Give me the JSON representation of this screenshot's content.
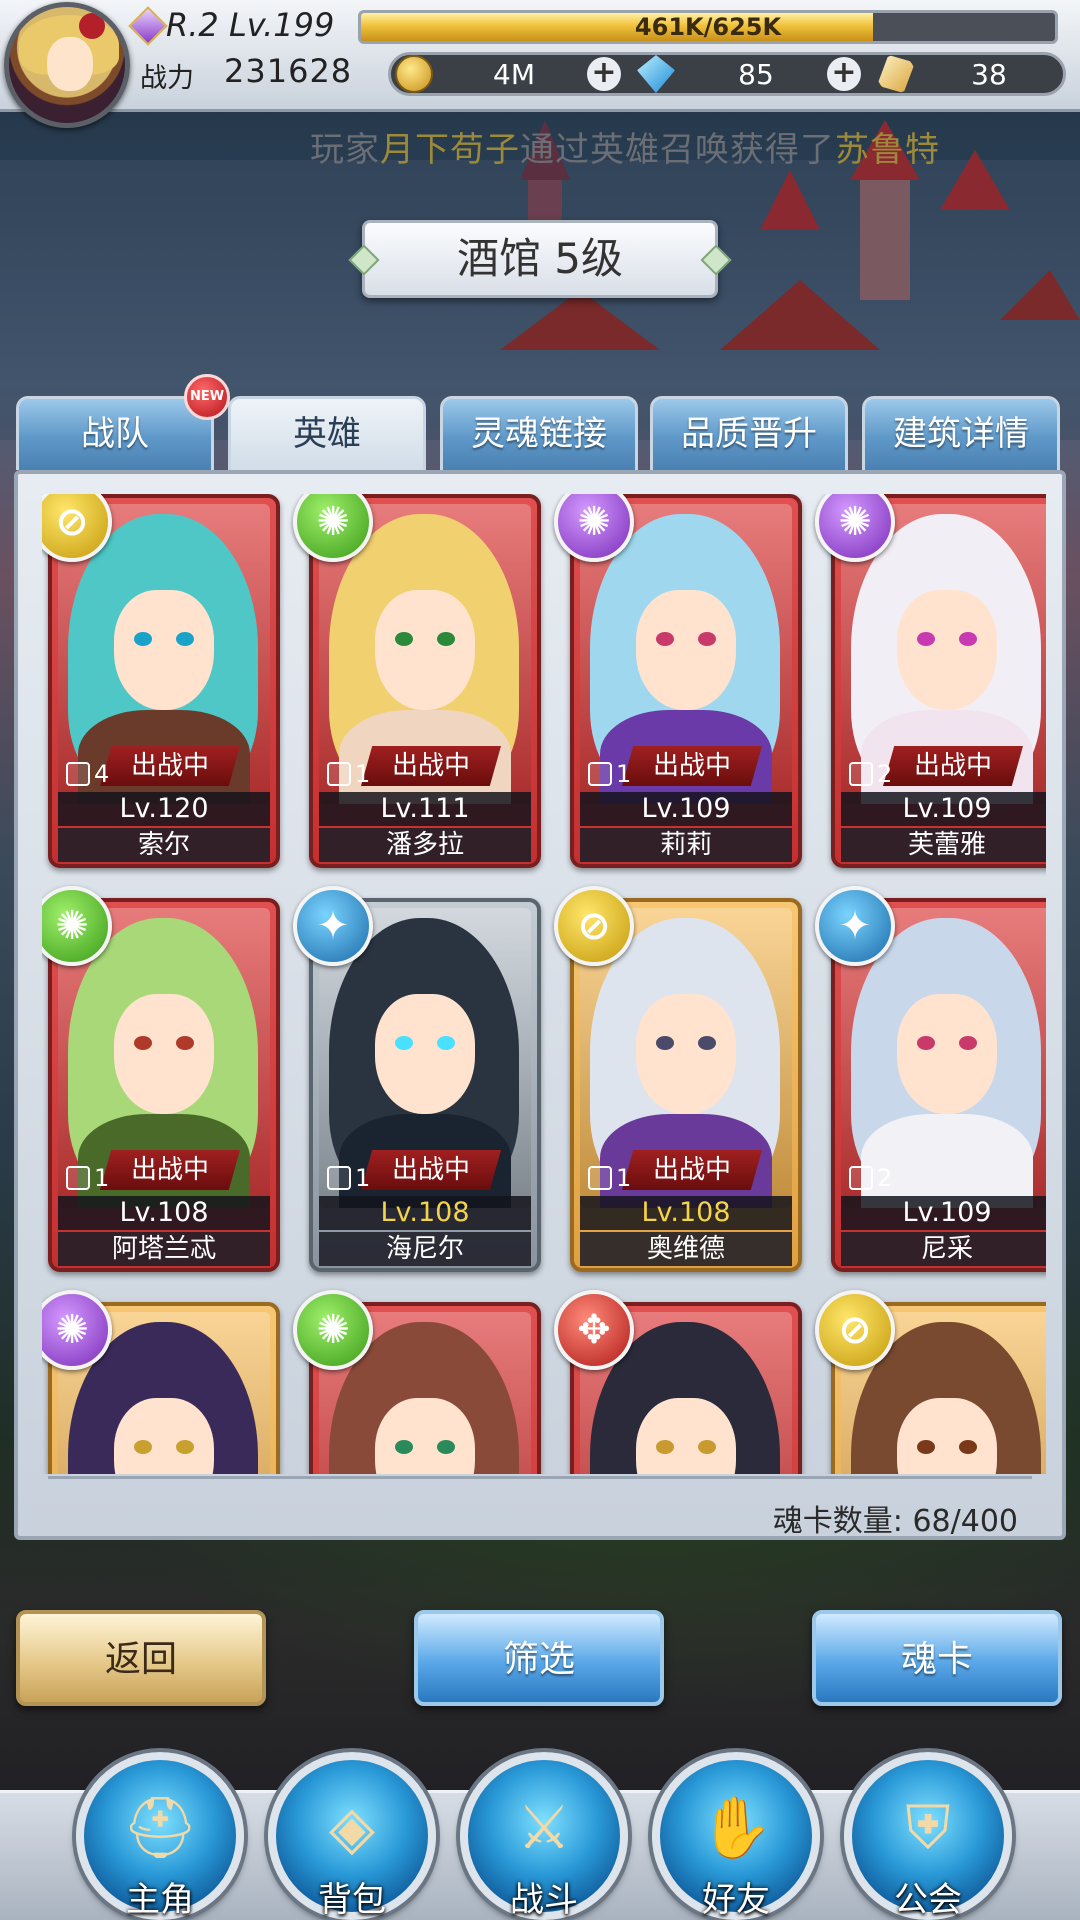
{
  "player": {
    "rank_level": "R.2 Lv.199",
    "xp_text": "461K/625K",
    "xp_fraction": 0.7376,
    "power_label": "战力",
    "power_value": "231628"
  },
  "currencies": [
    {
      "icon": "gold-coin-icon",
      "value": "4M"
    },
    {
      "icon": "blue-diamond-icon",
      "value": "85"
    },
    {
      "icon": "gold-crystal-icon",
      "value": "38"
    }
  ],
  "ticker": {
    "prefix": "玩家",
    "player_name": "月下苟子",
    "middle": "通过英雄召唤获得了",
    "hero_name": "苏鲁特"
  },
  "title": "酒馆 5级",
  "tabs": [
    {
      "label": "战队",
      "badge": "NEW",
      "active": false
    },
    {
      "label": "英雄",
      "active": true
    },
    {
      "label": "灵魂链接",
      "active": false
    },
    {
      "label": "品质晋升",
      "active": false
    },
    {
      "label": "建筑详情",
      "active": false
    }
  ],
  "cards": [
    {
      "name": "索尔",
      "level": "Lv.120",
      "count": "4",
      "status": "出战中",
      "element": "yellow",
      "frame": "red",
      "hair": "#4fc7c6",
      "eye": "#1aa3c8",
      "body": "#6a3a2a"
    },
    {
      "name": "潘多拉",
      "level": "Lv.111",
      "count": "1",
      "status": "出战中",
      "element": "green",
      "frame": "red",
      "hair": "#f1d070",
      "eye": "#2a8a3a",
      "body": "#f0d6c0"
    },
    {
      "name": "莉莉",
      "level": "Lv.109",
      "count": "1",
      "status": "出战中",
      "element": "purple",
      "frame": "red",
      "hair": "#9fd8ee",
      "eye": "#c83a6a",
      "body": "#6a3aa8"
    },
    {
      "name": "芙蕾雅",
      "level": "Lv.109",
      "count": "2",
      "status": "出战中",
      "element": "purple",
      "frame": "red",
      "hair": "#f2eef6",
      "eye": "#c83ab0",
      "body": "#f2e4ee"
    },
    {
      "name": "阿塔兰忒",
      "level": "Lv.108",
      "count": "1",
      "status": "出战中",
      "element": "green",
      "frame": "red",
      "hair": "#a8d878",
      "eye": "#b03a2a",
      "body": "#4a6a2a"
    },
    {
      "name": "海尼尔",
      "level": "Lv.108",
      "count": "1",
      "status": "出战中",
      "element": "blue",
      "frame": "silver",
      "hair": "#2a3440",
      "eye": "#4ae0ff",
      "body": "#1a2430",
      "level_yellow": true
    },
    {
      "name": "奥维德",
      "level": "Lv.108",
      "count": "1",
      "status": "出战中",
      "element": "yellow",
      "frame": "gold",
      "hair": "#dde4ee",
      "eye": "#4a4a6a",
      "body": "#6a3a9a",
      "level_yellow": true
    },
    {
      "name": "尼采",
      "level": "Lv.109",
      "count": "2",
      "status": "",
      "element": "blue",
      "frame": "red",
      "hair": "#c8d8ea",
      "eye": "#c83a6a",
      "body": "#f2f2f6"
    },
    {
      "name": "",
      "level": "",
      "count": "",
      "status": "",
      "element": "purple",
      "frame": "gold",
      "hair": "#3a2a5a",
      "eye": "#c8a030",
      "body": "#3a2a5a"
    },
    {
      "name": "",
      "level": "",
      "count": "",
      "status": "",
      "element": "green",
      "frame": "red",
      "hair": "#8a4a3a",
      "eye": "#2a8a5a",
      "body": "#8a4a3a"
    },
    {
      "name": "",
      "level": "",
      "count": "",
      "status": "",
      "element": "red",
      "frame": "red",
      "hair": "#2a2a3a",
      "eye": "#c89a30",
      "body": "#2a2a3a"
    },
    {
      "name": "",
      "level": "",
      "count": "",
      "status": "",
      "element": "yellow",
      "frame": "gold",
      "hair": "#7a4a30",
      "eye": "#7a3a1a",
      "body": "#7a4a30"
    }
  ],
  "soul_count": "魂卡数量: 68/400",
  "buttons": {
    "back": "返回",
    "filter": "筛选",
    "soul_card": "魂卡"
  },
  "nav": [
    {
      "label": "主角",
      "icon": "helmet-icon"
    },
    {
      "label": "背包",
      "icon": "backpack-icon"
    },
    {
      "label": "战斗",
      "icon": "crossed-swords-icon"
    },
    {
      "label": "好友",
      "icon": "handshake-icon"
    },
    {
      "label": "公会",
      "icon": "guild-crest-icon"
    }
  ]
}
